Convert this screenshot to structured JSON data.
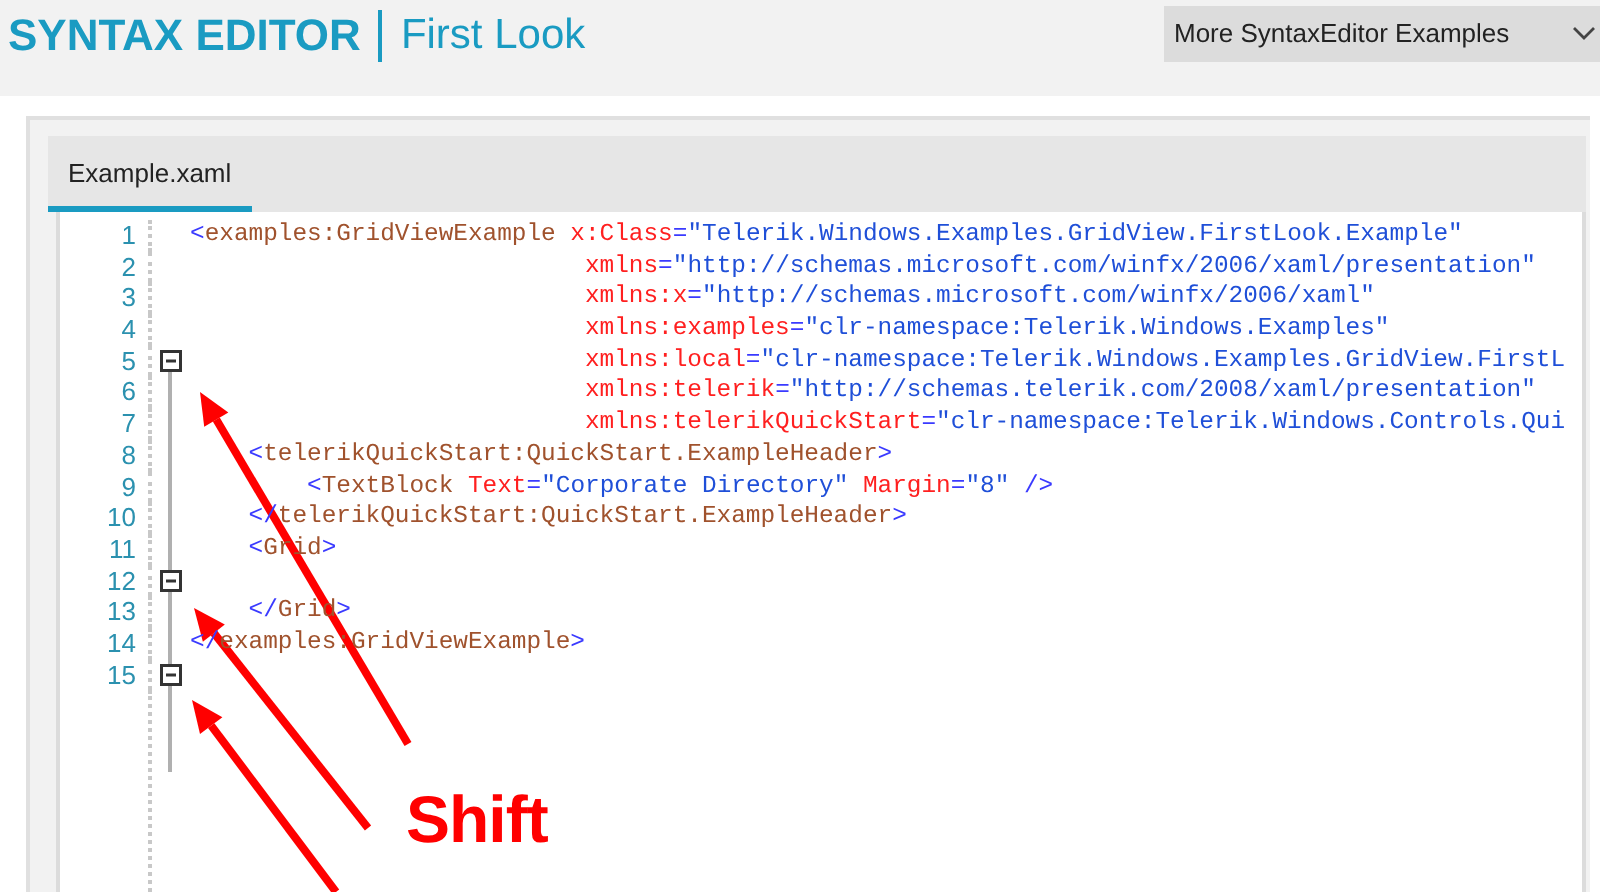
{
  "header": {
    "title": "SYNTAX EDITOR",
    "subtitle": "First Look"
  },
  "examples_dropdown": {
    "label": "More SyntaxEditor Examples"
  },
  "tabs": [
    {
      "label": "Example.xaml",
      "selected": true
    }
  ],
  "editor": {
    "lines": [
      {
        "number": "1",
        "foldable": false,
        "tokens": [
          {
            "kind": "punct",
            "text": "<"
          },
          {
            "kind": "elem",
            "text": "examples:GridViewExample "
          },
          {
            "kind": "attr",
            "text": "x:Class"
          },
          {
            "kind": "punct",
            "text": "="
          },
          {
            "kind": "value",
            "text": "\"Telerik.Windows.Examples.GridView.FirstLook.Example\""
          }
        ]
      },
      {
        "number": "2",
        "foldable": false,
        "tokens": [
          {
            "kind": "attr",
            "text": "                           xmlns"
          },
          {
            "kind": "punct",
            "text": "="
          },
          {
            "kind": "value",
            "text": "\"http://schemas.microsoft.com/winfx/2006/xaml/presentation\""
          }
        ]
      },
      {
        "number": "3",
        "foldable": false,
        "tokens": [
          {
            "kind": "attr",
            "text": "                           xmlns:x"
          },
          {
            "kind": "punct",
            "text": "="
          },
          {
            "kind": "value",
            "text": "\"http://schemas.microsoft.com/winfx/2006/xaml\""
          }
        ]
      },
      {
        "number": "4",
        "foldable": false,
        "tokens": [
          {
            "kind": "attr",
            "text": "                           xmlns:examples"
          },
          {
            "kind": "punct",
            "text": "="
          },
          {
            "kind": "value",
            "text": "\"clr-namespace:Telerik.Windows.Examples\""
          }
        ]
      },
      {
        "number": "5",
        "foldable": true,
        "tokens": [
          {
            "kind": "attr",
            "text": "                           xmlns:local"
          },
          {
            "kind": "punct",
            "text": "="
          },
          {
            "kind": "value",
            "text": "\"clr-namespace:Telerik.Windows.Examples.GridView.FirstL"
          }
        ]
      },
      {
        "number": "6",
        "foldable": false,
        "tokens": [
          {
            "kind": "attr",
            "text": "                           xmlns:telerik"
          },
          {
            "kind": "punct",
            "text": "="
          },
          {
            "kind": "value",
            "text": "\"http://schemas.telerik.com/2008/xaml/presentation\""
          }
        ]
      },
      {
        "number": "7",
        "foldable": false,
        "tokens": [
          {
            "kind": "attr",
            "text": "                           xmlns:telerikQuickStart"
          },
          {
            "kind": "punct",
            "text": "="
          },
          {
            "kind": "value",
            "text": "\"clr-namespace:Telerik.Windows.Controls.Qui"
          }
        ]
      },
      {
        "number": "8",
        "foldable": false,
        "tokens": [
          {
            "kind": "punct",
            "text": "    <"
          },
          {
            "kind": "elem",
            "text": "telerikQuickStart:QuickStart.ExampleHeader"
          },
          {
            "kind": "punct",
            "text": ">"
          }
        ]
      },
      {
        "number": "9",
        "foldable": false,
        "tokens": [
          {
            "kind": "punct",
            "text": "        <"
          },
          {
            "kind": "elem",
            "text": "TextBlock "
          },
          {
            "kind": "attr",
            "text": "Text"
          },
          {
            "kind": "punct",
            "text": "="
          },
          {
            "kind": "value",
            "text": "\"Corporate Directory\" "
          },
          {
            "kind": "attr",
            "text": "Margin"
          },
          {
            "kind": "punct",
            "text": "="
          },
          {
            "kind": "value",
            "text": "\"8\" "
          },
          {
            "kind": "punct",
            "text": "/>"
          }
        ]
      },
      {
        "number": "10",
        "foldable": false,
        "tokens": [
          {
            "kind": "punct",
            "text": "    </"
          },
          {
            "kind": "elem",
            "text": "telerikQuickStart:QuickStart.ExampleHeader"
          },
          {
            "kind": "punct",
            "text": ">"
          }
        ]
      },
      {
        "number": "11",
        "foldable": false,
        "tokens": [
          {
            "kind": "punct",
            "text": "    <"
          },
          {
            "kind": "elem",
            "text": "Grid"
          },
          {
            "kind": "punct",
            "text": ">"
          }
        ]
      },
      {
        "number": "12",
        "foldable": true
      },
      {
        "number": "13",
        "foldable": false,
        "tokens": [
          {
            "kind": "punct",
            "text": "    </"
          },
          {
            "kind": "elem",
            "text": "Grid"
          },
          {
            "kind": "punct",
            "text": ">"
          }
        ]
      },
      {
        "number": "14",
        "foldable": false,
        "tokens": [
          {
            "kind": "punct",
            "text": "</"
          },
          {
            "kind": "elem",
            "text": "examples:GridViewExample"
          },
          {
            "kind": "punct",
            "text": ">"
          }
        ]
      },
      {
        "number": "15",
        "foldable": true
      }
    ]
  },
  "annotation": {
    "label": "Shift"
  }
}
